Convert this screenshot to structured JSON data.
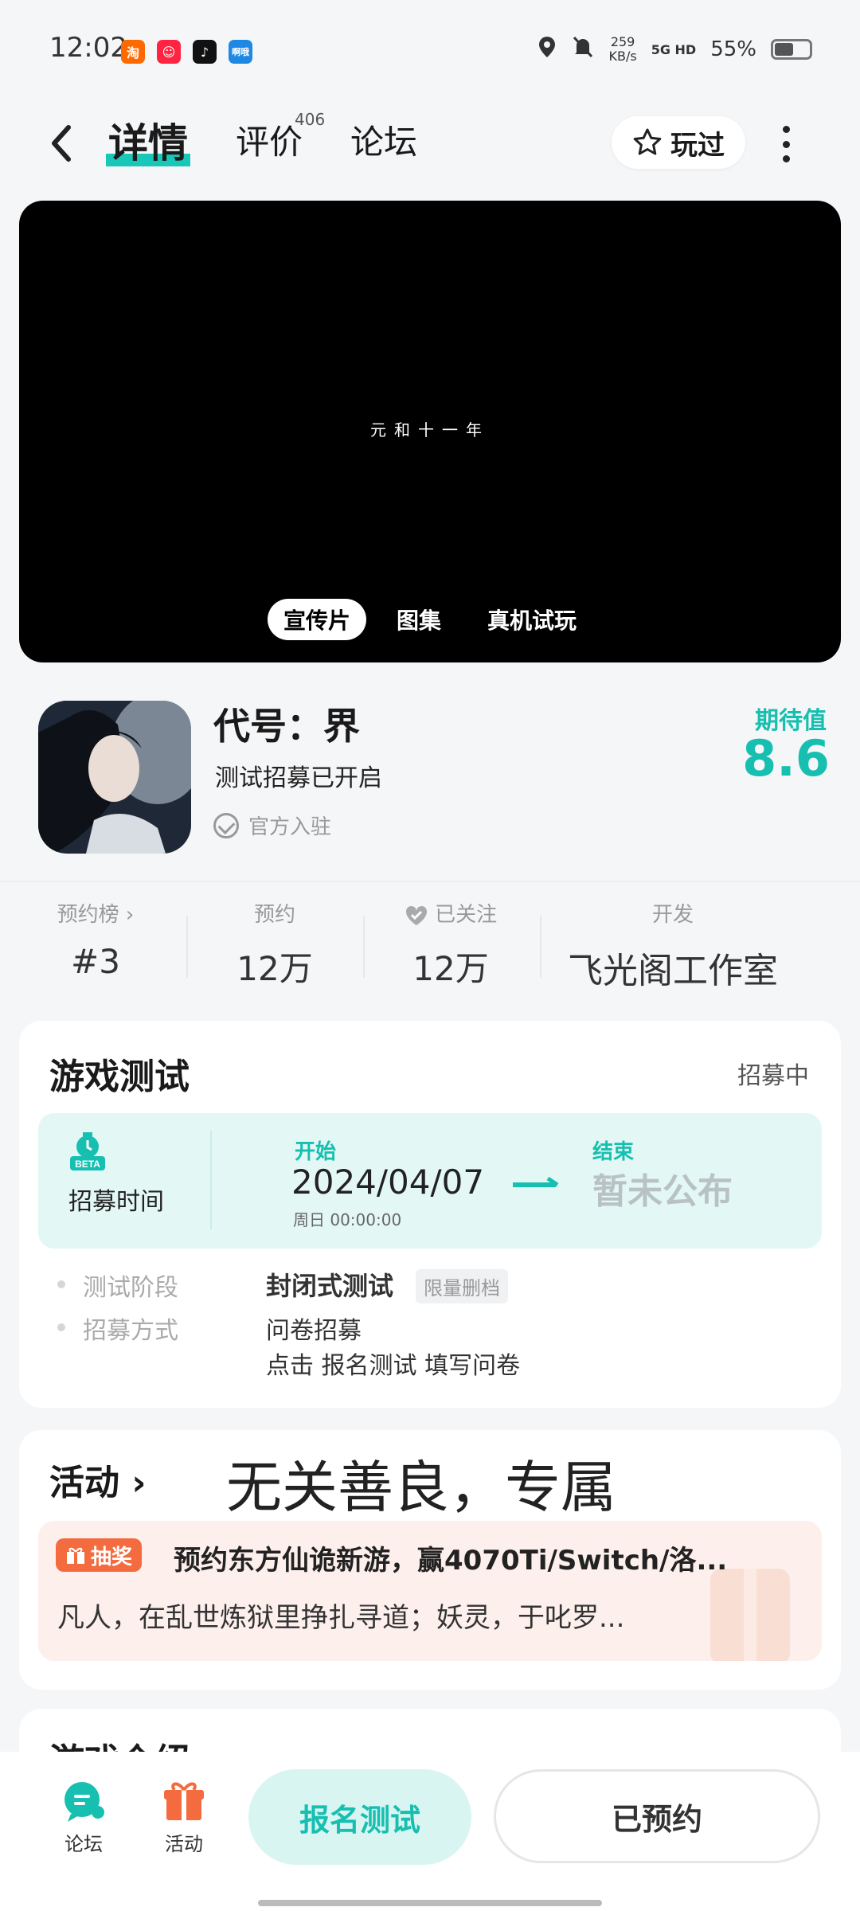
{
  "status_bar": {
    "time": "12:02",
    "apps": [
      {
        "name": "taobao",
        "glyph": "淘",
        "color": "#ff6a00"
      },
      {
        "name": "xiaohongshu",
        "glyph": "😊",
        "color": "#ff2442"
      },
      {
        "name": "douyin",
        "glyph": "♪",
        "color": "#111111"
      },
      {
        "name": "app",
        "glyph": "啊哦",
        "color": "#1e88e5"
      }
    ],
    "net_speed": "259",
    "net_unit": "KB/s",
    "network": "5G HD",
    "battery": "55%",
    "battery_level": 0.55
  },
  "header": {
    "tabs": [
      {
        "label": "详情",
        "active": true
      },
      {
        "label": "评价",
        "badge": "406"
      },
      {
        "label": "论坛"
      }
    ],
    "played_label": "玩过"
  },
  "video": {
    "caption": "元和十一年",
    "media_tabs": [
      "宣传片",
      "图集",
      "真机试玩"
    ],
    "active_tab": 0
  },
  "game": {
    "title": "代号：界",
    "subtitle": "测试招募已开启",
    "official": "官方入驻",
    "expect_label": "期待值",
    "expect_score": "8.6"
  },
  "stats": [
    {
      "label": "预约榜 ›",
      "value": "#3"
    },
    {
      "label": "预约",
      "value": "12万"
    },
    {
      "label": "已关注",
      "value": "12万"
    },
    {
      "label": "开发",
      "value": "飞光阁工作室"
    }
  ],
  "test_card": {
    "title": "游戏测试",
    "status": "招募中",
    "recruit_label": "招募时间",
    "start_label": "开始",
    "start_date": "2024/04/07",
    "start_time": "周日 00:00:00",
    "end_label": "结束",
    "end_value": "暂未公布",
    "rows": [
      {
        "label": "测试阶段",
        "value": "封闭式测试",
        "tag": "限量删档"
      },
      {
        "label": "招募方式",
        "value": "问卷招募",
        "value2": "点击 报名测试 填写问卷"
      }
    ]
  },
  "activity": {
    "title": "活动 ›",
    "banner_text": "无关善良，专属",
    "lottery_tag": "抽奖",
    "headline": "预约东方仙诡新游，赢4070Ti/Switch/洛...",
    "desc": "凡人，在乱世炼狱里挣扎寻道；妖灵，于叱罗..."
  },
  "intro": {
    "title": "游戏介绍 ›"
  },
  "bottom": {
    "forum": "论坛",
    "activity": "活动",
    "signup": "报名测试",
    "reserved": "已预约"
  }
}
